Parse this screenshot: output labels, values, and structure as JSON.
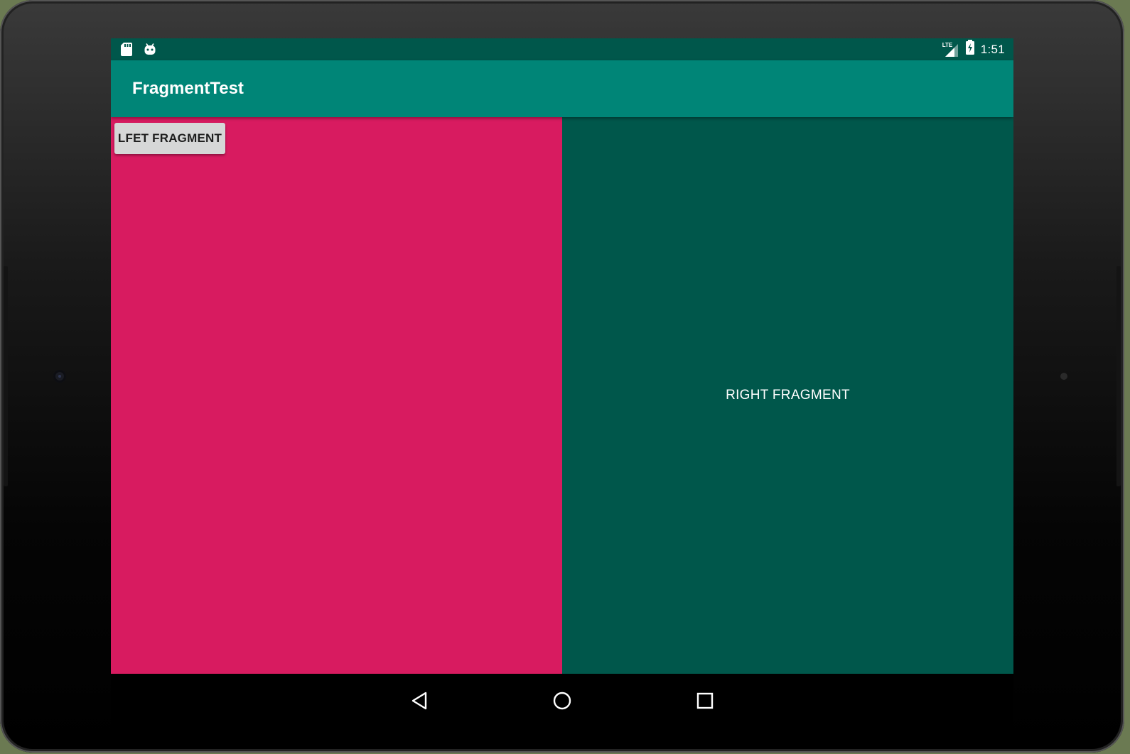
{
  "status_bar": {
    "time": "1:51",
    "network_label": "LTE",
    "icons": [
      "sd-card-icon",
      "android-icon",
      "signal-icon",
      "battery-icon"
    ]
  },
  "app_bar": {
    "title": "FragmentTest"
  },
  "left_fragment": {
    "button_label": "LFET FRAGMENT",
    "background_color": "#d81b60"
  },
  "right_fragment": {
    "text": "RIGHT FRAGMENT",
    "background_color": "#00574b"
  },
  "nav_bar": {
    "buttons": [
      "back-icon",
      "home-icon",
      "recents-icon"
    ]
  },
  "colors": {
    "status_bar": "#00574b",
    "app_bar": "#008577",
    "button": "#d6d7d7"
  }
}
